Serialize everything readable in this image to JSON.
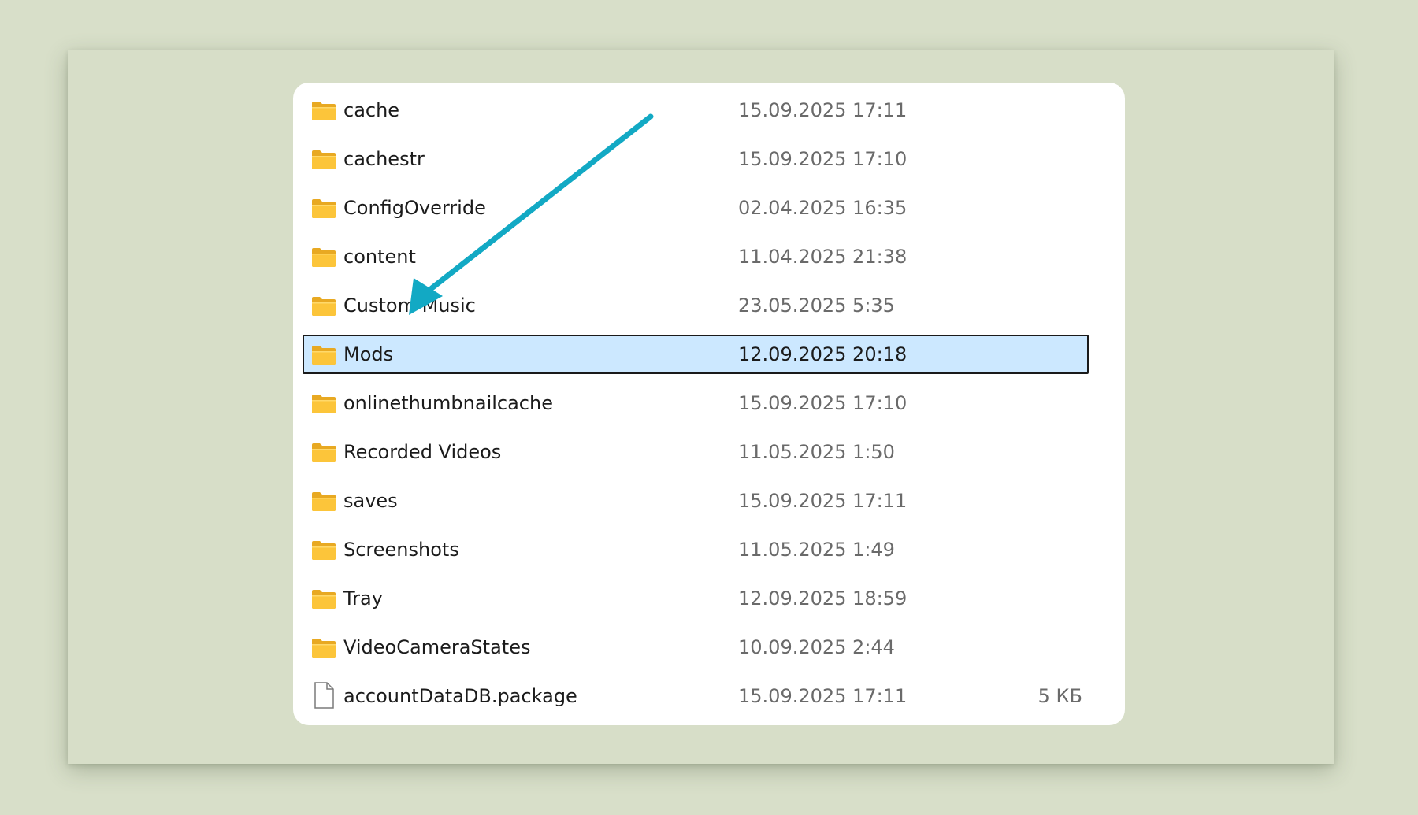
{
  "arrow_color": "#12a9c4",
  "highlight_color": "#cce8ff",
  "files": [
    {
      "name": "cache",
      "date": "15.09.2025 17:11",
      "size": "",
      "type": "folder",
      "selected": false
    },
    {
      "name": "cachestr",
      "date": "15.09.2025 17:10",
      "size": "",
      "type": "folder",
      "selected": false
    },
    {
      "name": "ConfigOverride",
      "date": "02.04.2025 16:35",
      "size": "",
      "type": "folder",
      "selected": false
    },
    {
      "name": "content",
      "date": "11.04.2025 21:38",
      "size": "",
      "type": "folder",
      "selected": false
    },
    {
      "name": "Custom Music",
      "date": "23.05.2025 5:35",
      "size": "",
      "type": "folder",
      "selected": false
    },
    {
      "name": "Mods",
      "date": "12.09.2025 20:18",
      "size": "",
      "type": "folder",
      "selected": true
    },
    {
      "name": "onlinethumbnailcache",
      "date": "15.09.2025 17:10",
      "size": "",
      "type": "folder",
      "selected": false
    },
    {
      "name": "Recorded Videos",
      "date": "11.05.2025 1:50",
      "size": "",
      "type": "folder",
      "selected": false
    },
    {
      "name": "saves",
      "date": "15.09.2025 17:11",
      "size": "",
      "type": "folder",
      "selected": false
    },
    {
      "name": "Screenshots",
      "date": "11.05.2025 1:49",
      "size": "",
      "type": "folder",
      "selected": false
    },
    {
      "name": "Tray",
      "date": "12.09.2025 18:59",
      "size": "",
      "type": "folder",
      "selected": false
    },
    {
      "name": "VideoCameraStates",
      "date": "10.09.2025 2:44",
      "size": "",
      "type": "folder",
      "selected": false
    },
    {
      "name": "accountDataDB.package",
      "date": "15.09.2025 17:11",
      "size": "5 КБ",
      "type": "file",
      "selected": false
    }
  ]
}
